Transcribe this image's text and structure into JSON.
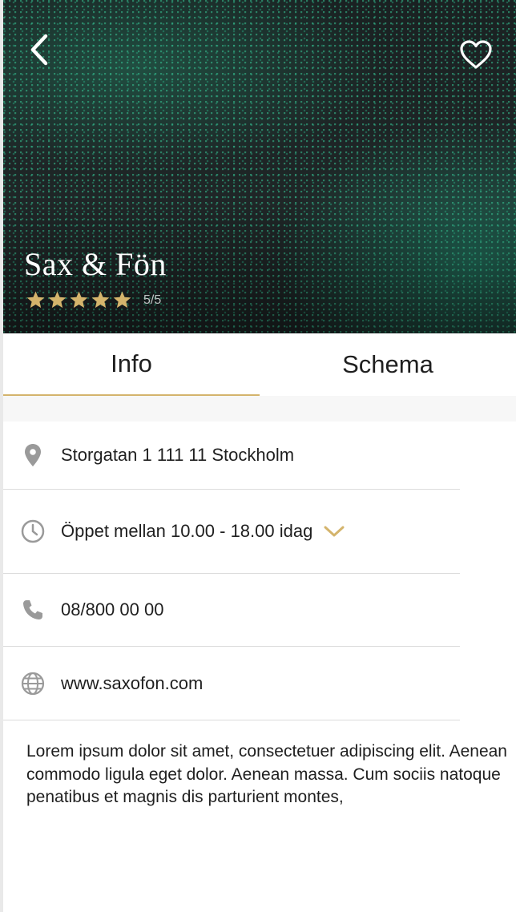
{
  "header": {
    "title": "Sax & Fön",
    "rating": {
      "stars": 5,
      "max": 5,
      "label": "5/5"
    },
    "back_icon": "chevron-left-icon",
    "favorite_icon": "heart-outline-icon"
  },
  "tabs": [
    {
      "label": "Info",
      "active": true
    },
    {
      "label": "Schema",
      "active": false
    }
  ],
  "info": {
    "address": "Storgatan 1 111 11 Stockholm",
    "hours": "Öppet mellan 10.00 - 18.00 idag",
    "phone": "08/800 00 00",
    "website": "www.saxofon.com"
  },
  "description": "Lorem ipsum dolor sit amet, consectetuer adipiscing elit. Aenean commodo ligula eget dolor. Aenean massa. Cum sociis natoque penatibus et magnis dis parturient montes,",
  "colors": {
    "accent": "#d4b46c",
    "icon_gray": "#9a9a9a",
    "hero_green": "#38c896"
  }
}
